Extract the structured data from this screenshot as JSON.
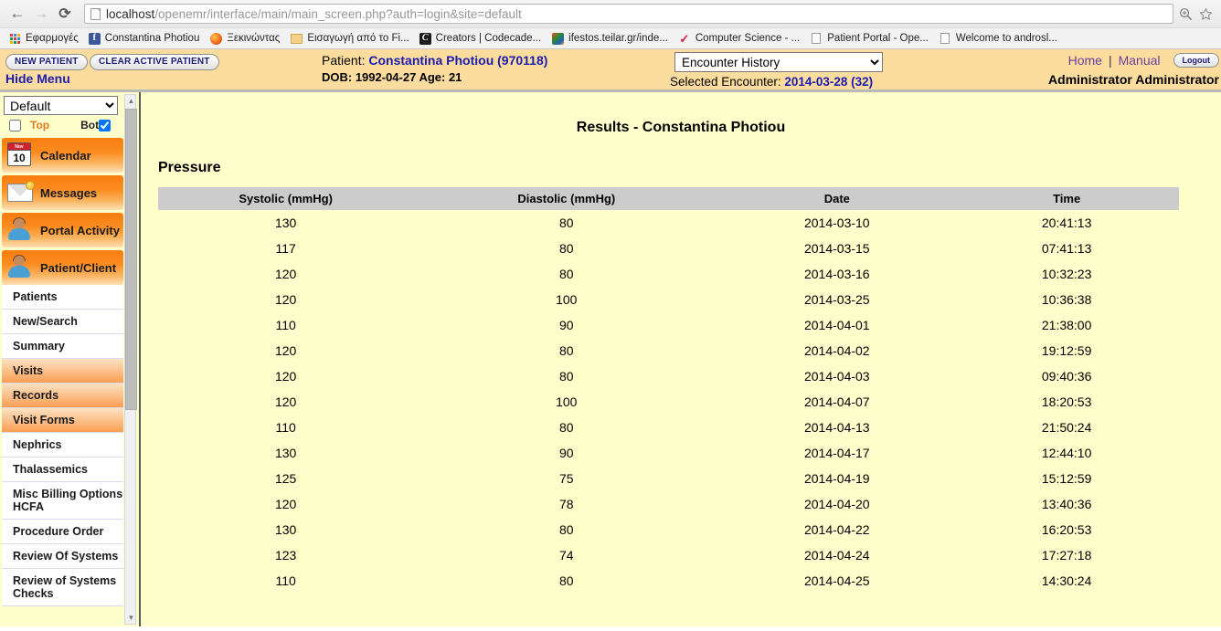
{
  "browser": {
    "back_icon": "back-arrow-icon",
    "forward_icon": "forward-arrow-icon",
    "reload_icon": "reload-icon",
    "url_host": "localhost",
    "url_path": "/openemr/interface/main/main_screen.php?auth=login&site=default",
    "zoom_icon": "zoom-in-icon",
    "star_icon": "bookmark-star-icon",
    "bookmarks": [
      {
        "label": "Εφαρμογές",
        "icon": "apps-grid-icon"
      },
      {
        "label": "Constantina Photiou",
        "icon": "facebook-icon"
      },
      {
        "label": "Ξεκινώντας",
        "icon": "firefox-icon"
      },
      {
        "label": "Εισαγωγή από το Fi...",
        "icon": "folder-icon"
      },
      {
        "label": "Creators | Codecade...",
        "icon": "codecademy-icon"
      },
      {
        "label": "ifestos.teilar.gr/inde...",
        "icon": "joomla-icon"
      },
      {
        "label": "Computer Science - ...",
        "icon": "checkmark-icon"
      },
      {
        "label": "Patient Portal - Ope...",
        "icon": "page-icon"
      },
      {
        "label": "Welcome to androsl...",
        "icon": "page-icon"
      }
    ]
  },
  "topbar": {
    "new_patient_label": "NEW PATIENT",
    "clear_patient_label": "CLEAR ACTIVE PATIENT",
    "hide_menu_label": "Hide Menu",
    "patient_prefix": "Patient: ",
    "patient_name": "Constantina Photiou (970118)",
    "dob_line": "DOB: 1992-04-27 Age: 21",
    "encounter_select_value": "Encounter History",
    "encounter_options": [
      "Encounter History"
    ],
    "selected_encounter_prefix": "Selected Encounter: ",
    "selected_encounter_value": "2014-03-28 (32)",
    "home_label": "Home",
    "separator": "|",
    "manual_label": "Manual",
    "logout_label": "Logout",
    "user_name": "Administrator Administrator"
  },
  "sidebar": {
    "area_select_value": "Default",
    "area_options": [
      "Default"
    ],
    "top_label": "Top",
    "bot_label": "Bot",
    "top_checked": false,
    "bot_checked": true,
    "big_buttons": [
      {
        "label": "Calendar",
        "icon": "calendar-icon",
        "day": "10",
        "month": "Nov"
      },
      {
        "label": "Messages",
        "icon": "envelope-icon"
      },
      {
        "label": "Portal Activity",
        "icon": "person-icon"
      },
      {
        "label": "Patient/Client",
        "icon": "person-icon"
      }
    ],
    "items": [
      {
        "label": "Patients",
        "highlighted": false
      },
      {
        "label": "New/Search",
        "highlighted": false
      },
      {
        "label": "Summary",
        "highlighted": false
      },
      {
        "label": "Visits",
        "highlighted": true
      },
      {
        "label": "Records",
        "highlighted": true
      },
      {
        "label": "Visit Forms",
        "highlighted": true
      },
      {
        "label": "Nephrics",
        "highlighted": false
      },
      {
        "label": "Thalassemics",
        "highlighted": false
      },
      {
        "label": "Misc Billing Options HCFA",
        "highlighted": false
      },
      {
        "label": "Procedure Order",
        "highlighted": false
      },
      {
        "label": "Review Of Systems",
        "highlighted": false
      },
      {
        "label": "Review of Systems Checks",
        "highlighted": false
      }
    ],
    "scroll_up_icon": "scroll-up-arrow-icon",
    "scroll_down_icon": "scroll-down-arrow-icon"
  },
  "main": {
    "results_title": "Results - Constantina Photiou",
    "section_title": "Pressure",
    "table": {
      "headers": [
        "Systolic (mmHg)",
        "Diastolic (mmHg)",
        "Date",
        "Time"
      ],
      "rows": [
        [
          "130",
          "80",
          "2014-03-10",
          "20:41:13"
        ],
        [
          "117",
          "80",
          "2014-03-15",
          "07:41:13"
        ],
        [
          "120",
          "80",
          "2014-03-16",
          "10:32:23"
        ],
        [
          "120",
          "100",
          "2014-03-25",
          "10:36:38"
        ],
        [
          "110",
          "90",
          "2014-04-01",
          "21:38:00"
        ],
        [
          "120",
          "80",
          "2014-04-02",
          "19:12:59"
        ],
        [
          "120",
          "80",
          "2014-04-03",
          "09:40:36"
        ],
        [
          "120",
          "100",
          "2014-04-07",
          "18:20:53"
        ],
        [
          "110",
          "80",
          "2014-04-13",
          "21:50:24"
        ],
        [
          "130",
          "90",
          "2014-04-17",
          "12:44:10"
        ],
        [
          "125",
          "75",
          "2014-04-19",
          "15:12:59"
        ],
        [
          "120",
          "78",
          "2014-04-20",
          "13:40:36"
        ],
        [
          "130",
          "80",
          "2014-04-22",
          "16:20:53"
        ],
        [
          "123",
          "74",
          "2014-04-24",
          "17:27:18"
        ],
        [
          "110",
          "80",
          "2014-04-25",
          "14:30:24"
        ]
      ]
    }
  },
  "colors": {
    "page_background": "#ffffcc",
    "topbar_background": "#fcdd9d",
    "table_header": "#cccccc",
    "accent_orange": "#f97c10",
    "link_blue": "#1b1bb0",
    "link_purple": "#6b3fa0"
  }
}
